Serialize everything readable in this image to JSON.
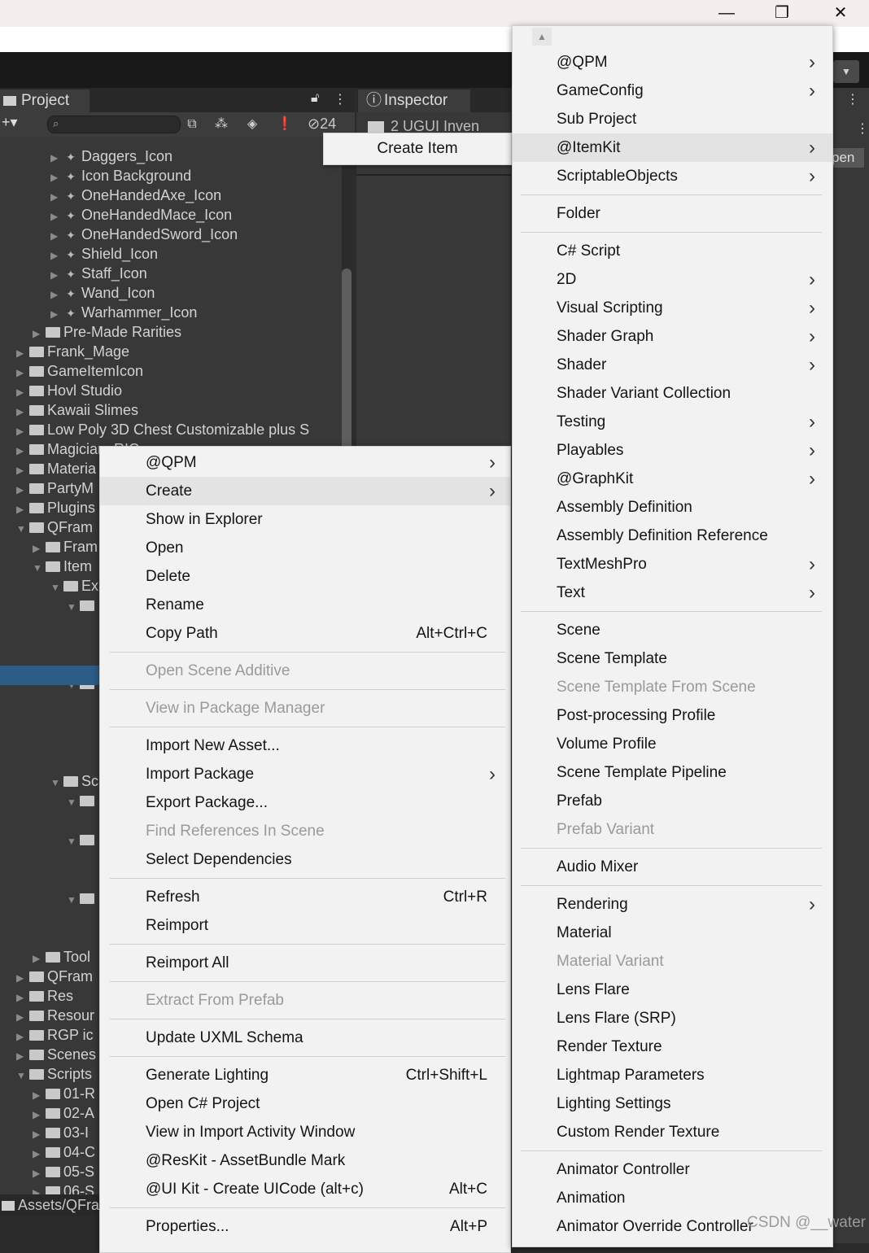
{
  "window": {
    "minimize": "—",
    "restore": "❐",
    "close": "✕"
  },
  "toolbar": {
    "dropdown_icon": "chevron-down"
  },
  "project_panel": {
    "tab_label": "Project",
    "add_label": "+▾",
    "hidden_count": "24",
    "tree": [
      {
        "label": "Daggers_Icon",
        "type": "asset",
        "arrow": "▶"
      },
      {
        "label": "Icon Background",
        "type": "asset",
        "arrow": "▶"
      },
      {
        "label": "OneHandedAxe_Icon",
        "type": "asset",
        "arrow": "▶"
      },
      {
        "label": "OneHandedMace_Icon",
        "type": "asset",
        "arrow": "▶"
      },
      {
        "label": "OneHandedSword_Icon",
        "type": "asset",
        "arrow": "▶"
      },
      {
        "label": "Shield_Icon",
        "type": "asset",
        "arrow": "▶"
      },
      {
        "label": "Staff_Icon",
        "type": "asset",
        "arrow": "▶"
      },
      {
        "label": "Wand_Icon",
        "type": "asset",
        "arrow": "▶"
      },
      {
        "label": "Warhammer_Icon",
        "type": "asset",
        "arrow": "▶"
      },
      {
        "label": "Pre-Made Rarities",
        "type": "folder",
        "arrow": "▶"
      },
      {
        "label": "Frank_Mage",
        "type": "folder",
        "arrow": "▶"
      },
      {
        "label": "GameItemIcon",
        "type": "folder",
        "arrow": "▶"
      },
      {
        "label": "Hovl Studio",
        "type": "folder",
        "arrow": "▶"
      },
      {
        "label": "Kawaii Slimes",
        "type": "folder",
        "arrow": "▶"
      },
      {
        "label": "Low Poly 3D Chest Customizable plus S",
        "type": "folder",
        "arrow": "▶"
      },
      {
        "label": "Magician_RIO",
        "type": "folder",
        "arrow": "▶"
      },
      {
        "label": "Materia",
        "type": "folder",
        "arrow": "▶"
      },
      {
        "label": "PartyM",
        "type": "folder",
        "arrow": "▶"
      },
      {
        "label": "Plugins",
        "type": "folder",
        "arrow": "▶"
      },
      {
        "label": "QFram",
        "type": "folder",
        "arrow": "▼"
      },
      {
        "label": "Fram",
        "type": "folder",
        "arrow": "▶"
      },
      {
        "label": "Item",
        "type": "folder",
        "arrow": "▼"
      },
      {
        "label": "Ex",
        "type": "folder",
        "arrow": "▼"
      },
      {
        "label": "",
        "type": "folder",
        "arrow": "▼"
      },
      {
        "label": "",
        "type": "folder",
        "arrow": "▼"
      },
      {
        "label": "Sc",
        "type": "folder",
        "arrow": "▼"
      },
      {
        "label": "",
        "type": "folder",
        "arrow": "▼"
      },
      {
        "label": "",
        "type": "folder",
        "arrow": "▼"
      },
      {
        "label": "",
        "type": "folder",
        "arrow": "▼"
      },
      {
        "label": "#",
        "type": "script",
        "arrow": ""
      },
      {
        "label": "Tool",
        "type": "folder",
        "arrow": "▶"
      },
      {
        "label": "QFram",
        "type": "folder",
        "arrow": "▶"
      },
      {
        "label": "Res",
        "type": "folder",
        "arrow": "▶"
      },
      {
        "label": "Resour",
        "type": "folder",
        "arrow": "▶"
      },
      {
        "label": "RGP ic",
        "type": "folder",
        "arrow": "▶"
      },
      {
        "label": "Scenes",
        "type": "folder",
        "arrow": "▶"
      },
      {
        "label": "Scripts",
        "type": "folder",
        "arrow": "▼"
      },
      {
        "label": "01-R",
        "type": "folder",
        "arrow": "▶"
      },
      {
        "label": "02-A",
        "type": "folder",
        "arrow": "▶"
      },
      {
        "label": "03-I",
        "type": "folder",
        "arrow": "▶"
      },
      {
        "label": "04-C",
        "type": "folder",
        "arrow": "▶"
      },
      {
        "label": "05-S",
        "type": "folder",
        "arrow": "▶"
      },
      {
        "label": "06-S",
        "type": "folder",
        "arrow": "▶"
      }
    ],
    "status_path": "Assets/QFra"
  },
  "inspector": {
    "tab_label": "Inspector",
    "object_name": "2 UGUI Inven",
    "open_label": "pen"
  },
  "tooltip": {
    "label": "Create Item"
  },
  "context_menu": {
    "items": [
      {
        "label": "@QPM",
        "submenu": true
      },
      {
        "label": "Create",
        "submenu": true,
        "highlight": true
      },
      {
        "label": "Show in Explorer"
      },
      {
        "label": "Open"
      },
      {
        "label": "Delete"
      },
      {
        "label": "Rename"
      },
      {
        "label": "Copy Path",
        "shortcut": "Alt+Ctrl+C"
      },
      {
        "sep": true
      },
      {
        "label": "Open Scene Additive",
        "disabled": true
      },
      {
        "sep": true
      },
      {
        "label": "View in Package Manager",
        "disabled": true
      },
      {
        "sep": true
      },
      {
        "label": "Import New Asset..."
      },
      {
        "label": "Import Package",
        "submenu": true
      },
      {
        "label": "Export Package..."
      },
      {
        "label": "Find References In Scene",
        "disabled": true
      },
      {
        "label": "Select Dependencies"
      },
      {
        "sep": true
      },
      {
        "label": "Refresh",
        "shortcut": "Ctrl+R"
      },
      {
        "label": "Reimport"
      },
      {
        "sep": true
      },
      {
        "label": "Reimport All"
      },
      {
        "sep": true
      },
      {
        "label": "Extract From Prefab",
        "disabled": true
      },
      {
        "sep": true
      },
      {
        "label": "Update UXML Schema"
      },
      {
        "sep": true
      },
      {
        "label": "Generate Lighting",
        "shortcut": "Ctrl+Shift+L"
      },
      {
        "label": "Open C# Project"
      },
      {
        "label": "View in Import Activity Window"
      },
      {
        "label": "@ResKit - AssetBundle Mark"
      },
      {
        "label": "@UI Kit - Create UICode (alt+c)",
        "shortcut": "Alt+C"
      },
      {
        "sep": true
      },
      {
        "label": "Properties...",
        "shortcut": "Alt+P"
      }
    ]
  },
  "create_submenu": {
    "items": [
      {
        "label": "@QPM",
        "submenu": true
      },
      {
        "label": "GameConfig",
        "submenu": true
      },
      {
        "label": "Sub Project"
      },
      {
        "label": "@ItemKit",
        "submenu": true,
        "highlight": true
      },
      {
        "label": "ScriptableObjects",
        "submenu": true
      },
      {
        "sep": true
      },
      {
        "label": "Folder"
      },
      {
        "sep": true
      },
      {
        "label": "C# Script"
      },
      {
        "label": "2D",
        "submenu": true
      },
      {
        "label": "Visual Scripting",
        "submenu": true
      },
      {
        "label": "Shader Graph",
        "submenu": true
      },
      {
        "label": "Shader",
        "submenu": true
      },
      {
        "label": "Shader Variant Collection"
      },
      {
        "label": "Testing",
        "submenu": true
      },
      {
        "label": "Playables",
        "submenu": true
      },
      {
        "label": "@GraphKit",
        "submenu": true
      },
      {
        "label": "Assembly Definition"
      },
      {
        "label": "Assembly Definition Reference"
      },
      {
        "label": "TextMeshPro",
        "submenu": true
      },
      {
        "label": "Text",
        "submenu": true
      },
      {
        "sep": true
      },
      {
        "label": "Scene"
      },
      {
        "label": "Scene Template"
      },
      {
        "label": "Scene Template From Scene",
        "disabled": true
      },
      {
        "label": "Post-processing Profile"
      },
      {
        "label": "Volume Profile"
      },
      {
        "label": "Scene Template Pipeline"
      },
      {
        "label": "Prefab"
      },
      {
        "label": "Prefab Variant",
        "disabled": true
      },
      {
        "sep": true
      },
      {
        "label": "Audio Mixer"
      },
      {
        "sep": true
      },
      {
        "label": "Rendering",
        "submenu": true
      },
      {
        "label": "Material"
      },
      {
        "label": "Material Variant",
        "disabled": true
      },
      {
        "label": "Lens Flare"
      },
      {
        "label": "Lens Flare (SRP)"
      },
      {
        "label": "Render Texture"
      },
      {
        "label": "Lightmap Parameters"
      },
      {
        "label": "Lighting Settings"
      },
      {
        "label": "Custom Render Texture"
      },
      {
        "sep": true
      },
      {
        "label": "Animator Controller"
      },
      {
        "label": "Animation"
      },
      {
        "label": "Animator Override Controller"
      }
    ]
  },
  "watermark": "CSDN @__water"
}
